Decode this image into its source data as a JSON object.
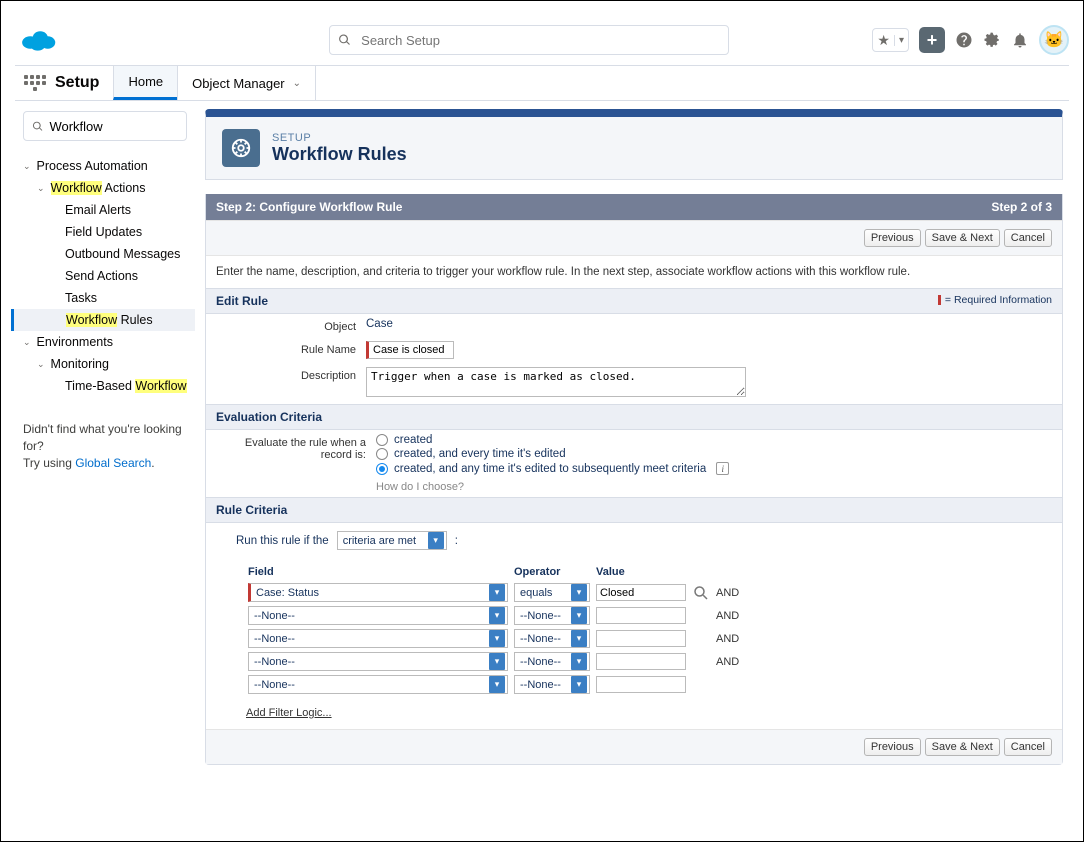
{
  "search": {
    "placeholder": "Search Setup"
  },
  "tabs": {
    "setup": "Setup",
    "home": "Home",
    "object_manager": "Object Manager"
  },
  "sidebar": {
    "search_value": "Workflow",
    "group1": "Process Automation",
    "wf_hl": "Workflow",
    "wf_actions_suffix": " Actions",
    "items": {
      "email_alerts": "Email Alerts",
      "field_updates": "Field Updates",
      "outbound": "Outbound Messages",
      "send_actions": "Send Actions",
      "tasks": "Tasks"
    },
    "wf_rules_suffix": " Rules",
    "group2": "Environments",
    "monitoring": "Monitoring",
    "tb_prefix": "Time-Based ",
    "note1": "Didn't find what you're looking for?",
    "note2": "Try using ",
    "note_link": "Global Search",
    "note3": "."
  },
  "banner": {
    "kicker": "SETUP",
    "title": "Workflow Rules"
  },
  "step": {
    "left": "Step 2: Configure Workflow Rule",
    "right": "Step 2 of 3"
  },
  "buttons": {
    "prev": "Previous",
    "save_next": "Save & Next",
    "cancel": "Cancel"
  },
  "instructions": "Enter the name, description, and criteria to trigger your workflow rule. In the next step, associate workflow actions with this workflow rule.",
  "edit_rule": {
    "header": "Edit Rule",
    "req": "= Required Information",
    "object_lbl": "Object",
    "object_val": "Case",
    "name_lbl": "Rule Name",
    "name_val": "Case is closed",
    "desc_lbl": "Description",
    "desc_val": "Trigger when a case is marked as closed."
  },
  "eval": {
    "header": "Evaluation Criteria",
    "label": "Evaluate the rule when a record is:",
    "opt1": "created",
    "opt2": "created, and every time it's edited",
    "opt3": "created, and any time it's edited to subsequently meet criteria",
    "how": "How do I choose?"
  },
  "rule_crit": {
    "header": "Rule Criteria",
    "run_lbl": "Run this rule if the",
    "run_sel": "criteria are met",
    "col_field": "Field",
    "col_op": "Operator",
    "col_val": "Value",
    "rows": [
      {
        "field": "Case: Status",
        "op": "equals",
        "val": "Closed",
        "and": "AND",
        "req": true,
        "lookup": true
      },
      {
        "field": "--None--",
        "op": "--None--",
        "val": "",
        "and": "AND"
      },
      {
        "field": "--None--",
        "op": "--None--",
        "val": "",
        "and": "AND"
      },
      {
        "field": "--None--",
        "op": "--None--",
        "val": "",
        "and": "AND"
      },
      {
        "field": "--None--",
        "op": "--None--",
        "val": "",
        "and": ""
      }
    ],
    "add_filter": "Add Filter Logic..."
  }
}
